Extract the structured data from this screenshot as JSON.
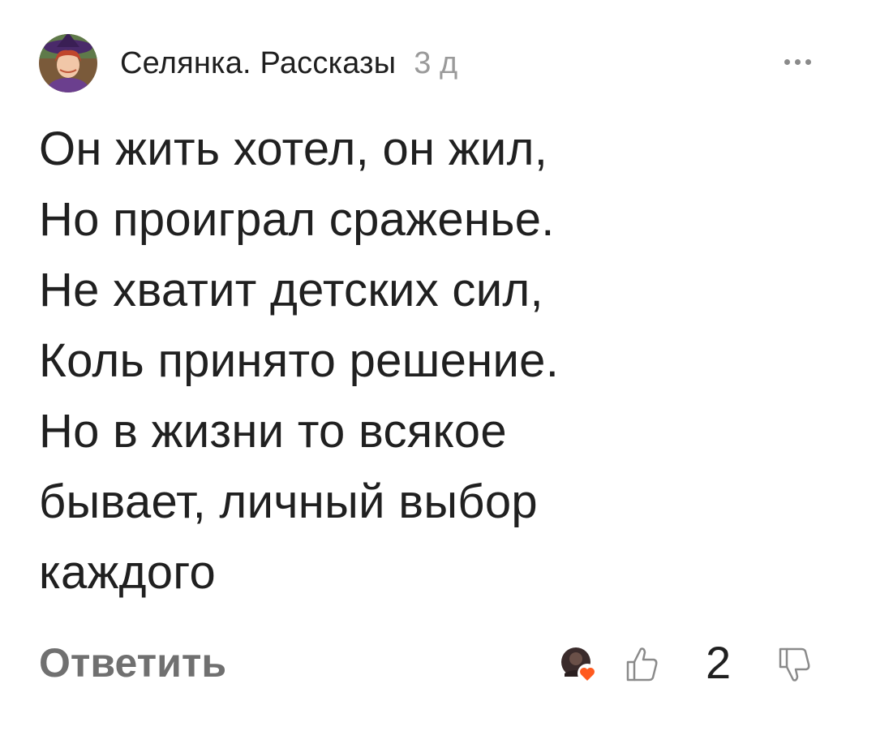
{
  "comment": {
    "author": "Селянка. Рассказы",
    "time": "3 д",
    "avatar_icon": "user-avatar-icon",
    "more_icon": "more-dots-icon",
    "lines": [
      "Он жить хотел, он жил,",
      "Но проиграл сраженье.",
      "Не хватит детских сил,",
      "Коль принято решение.",
      "Но в жизни то всякое",
      "бывает, личный выбор",
      "каждого"
    ]
  },
  "footer": {
    "reply_label": "Ответить",
    "likes_count": "2",
    "reactions_icon": "reaction-avatar-heart-icon",
    "like_icon": "thumbs-up-icon",
    "dislike_icon": "thumbs-down-icon"
  },
  "colors": {
    "text": "#202020",
    "muted": "#9a9a9a",
    "reply": "#707070",
    "heart": "#ff5a1f"
  }
}
